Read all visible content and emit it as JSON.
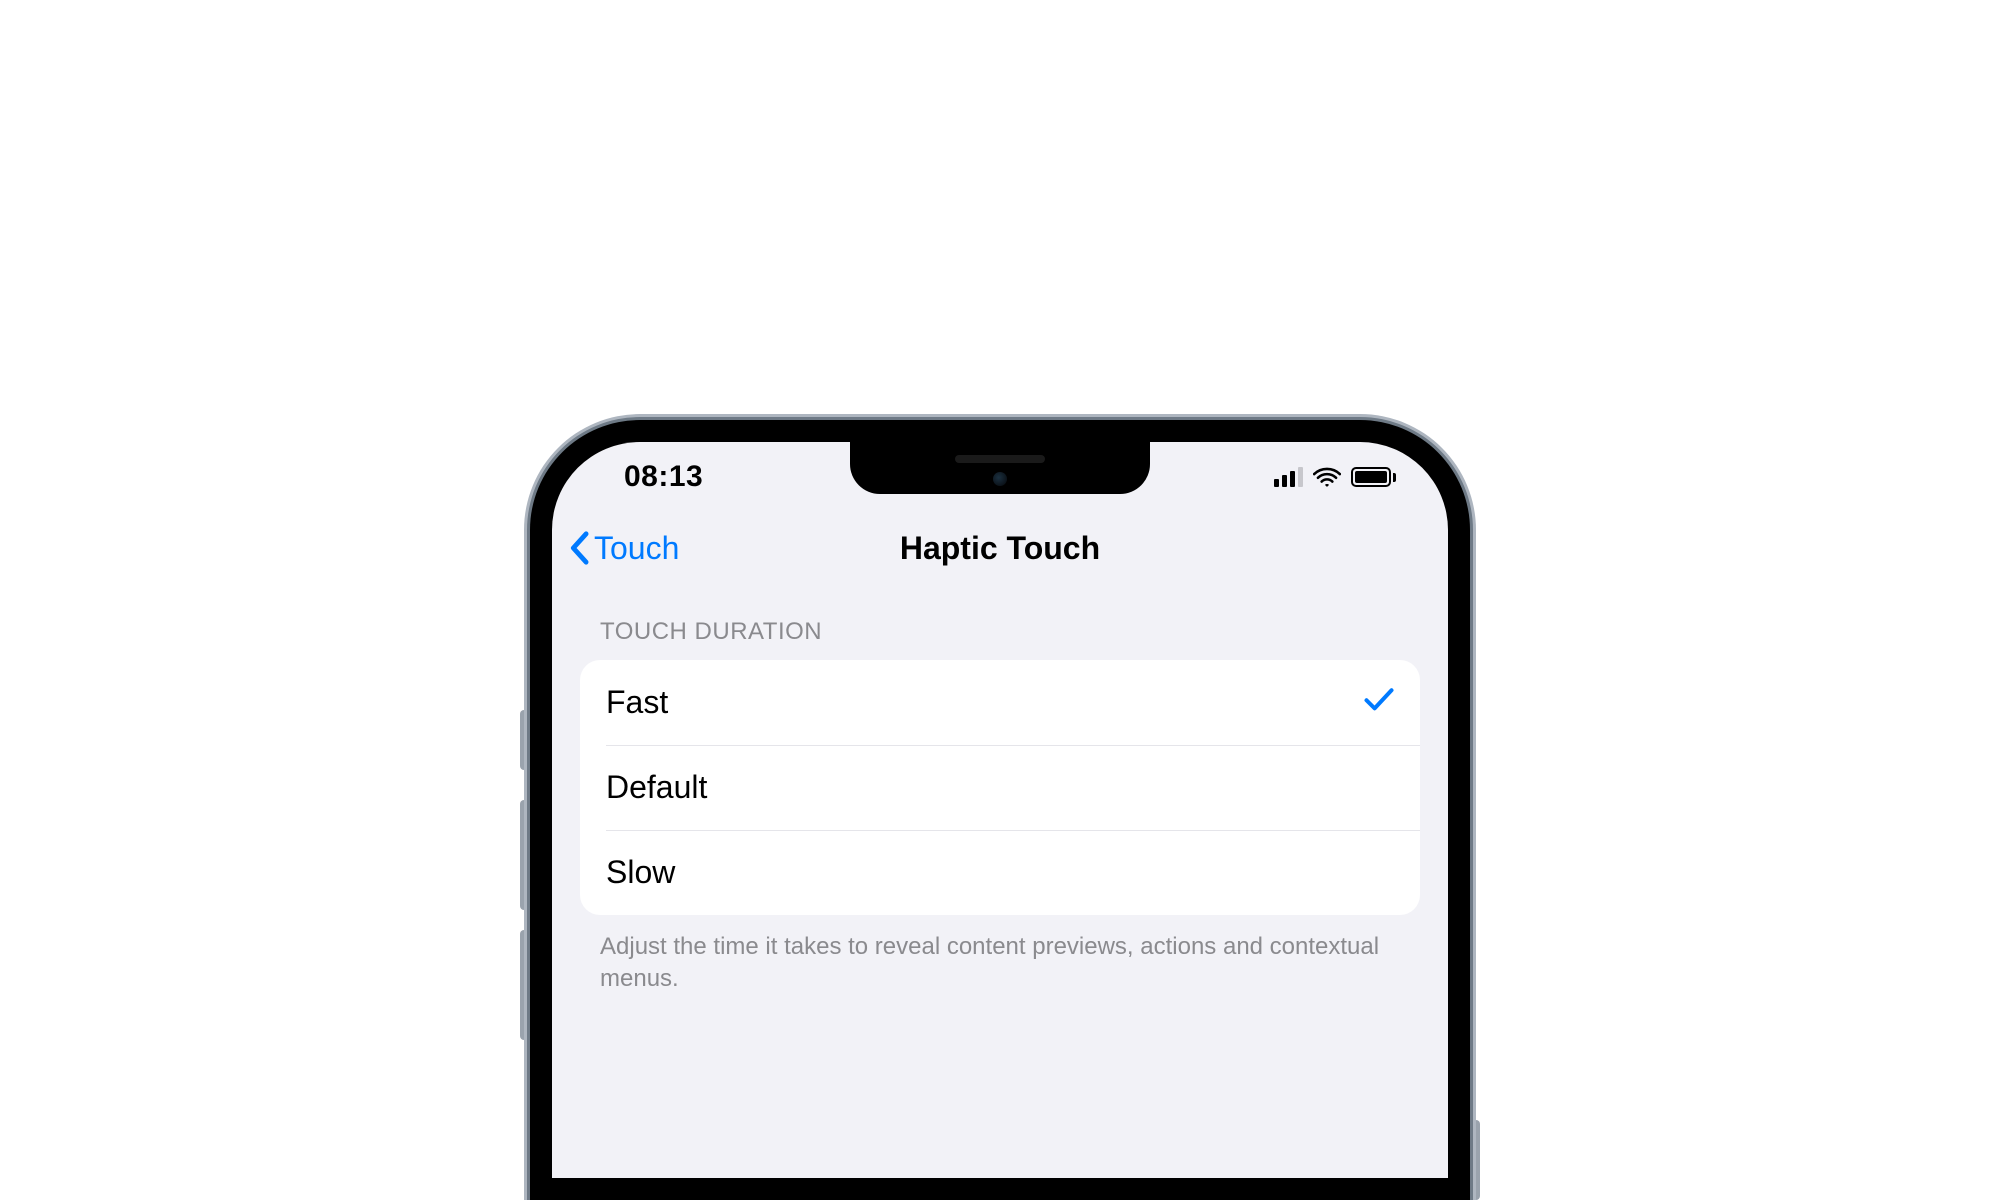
{
  "status": {
    "time": "08:13",
    "cellular_bars_active": 3,
    "cellular_bars_total": 4
  },
  "nav": {
    "back_label": "Touch",
    "title": "Haptic Touch"
  },
  "section": {
    "header": "TOUCH DURATION",
    "options": [
      {
        "label": "Fast",
        "selected": true
      },
      {
        "label": "Default",
        "selected": false
      },
      {
        "label": "Slow",
        "selected": false
      }
    ],
    "footer": "Adjust the time it takes to reveal content previews, actions and contextual menus."
  },
  "colors": {
    "accent": "#007aff",
    "bg": "#f2f2f7",
    "separator": "#e5e5ea",
    "text_secondary": "#8a8a8e"
  }
}
